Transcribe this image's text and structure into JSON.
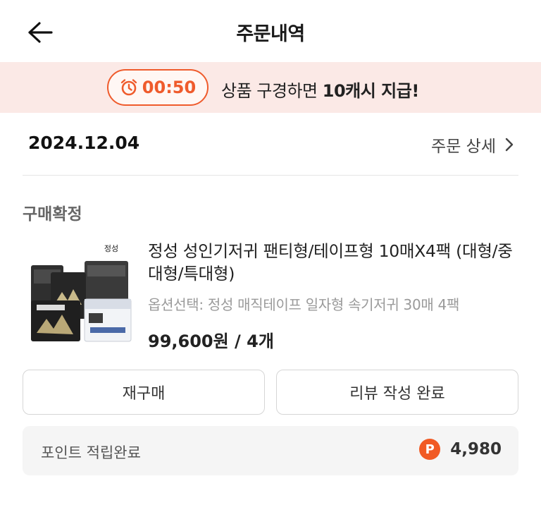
{
  "header": {
    "title": "주문내역",
    "back_icon": "arrow-left-icon"
  },
  "banner": {
    "timer": "00:50",
    "timer_icon": "alarm-clock-icon",
    "message_prefix": "상품 구경하면 ",
    "message_bold": "10캐시 지급!",
    "accent_color": "#ef5b2c",
    "background_color": "#fbe9e6"
  },
  "order": {
    "date": "2024.12.04",
    "detail_label": "주문 상세",
    "detail_icon": "chevron-right-icon",
    "status": "구매확정",
    "product": {
      "title": "정성 성인기저귀 팬티형/테이프형 10매X4팩 (대형/중대형/특대형)",
      "option": "옵션선택: 정성 매직테이프 일자형 속기저귀 30매 4팩",
      "price": "99,600원 / 4개",
      "brand_logo_text": "정성"
    }
  },
  "actions": {
    "rebuy_label": "재구매",
    "review_label": "리뷰 작성 완료"
  },
  "points": {
    "label": "포인트 적립완료",
    "badge": "P",
    "value": "4,980",
    "badge_color": "#f15a24"
  }
}
